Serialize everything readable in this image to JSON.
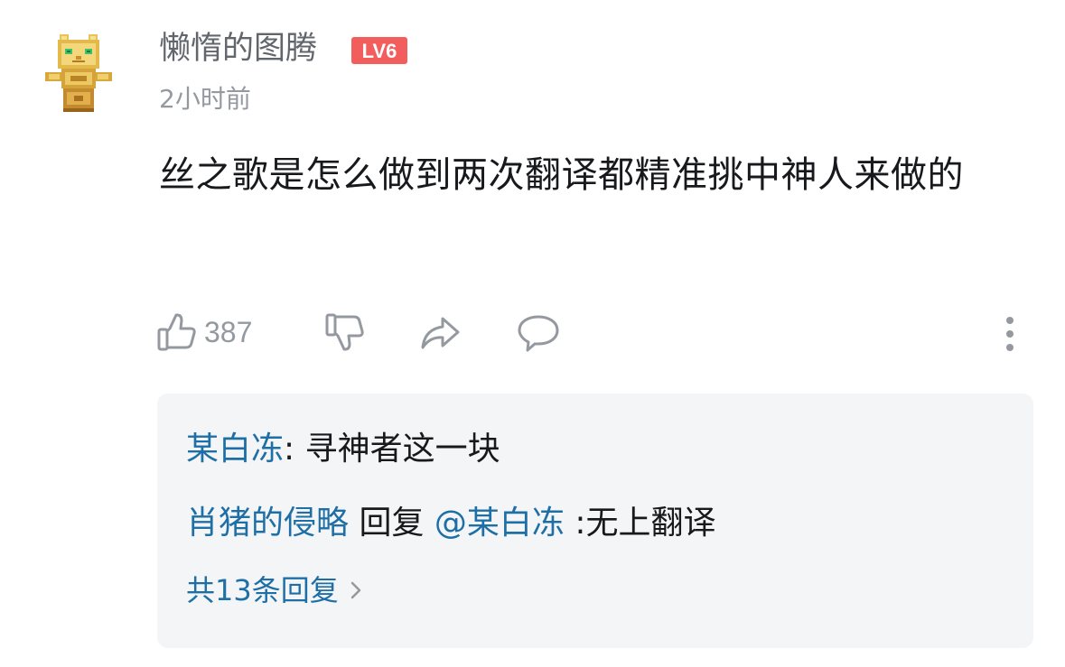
{
  "comment": {
    "username": "懒惰的图腾",
    "level_badge": "LV6",
    "timestamp": "2小时前",
    "text": "丝之歌是怎么做到两次翻译都精准挑中神人来做的"
  },
  "actions": {
    "like_count": "387",
    "icons": [
      "thumbs-up-icon",
      "thumbs-down-icon",
      "share-icon",
      "comment-icon",
      "more-vertical-icon"
    ]
  },
  "replies": {
    "items": [
      {
        "author": "某白冻",
        "separator": ":",
        "text": " 寻神者这一块"
      },
      {
        "author": "肖猪的侵略",
        "reply_word": " 回复 ",
        "mention": "@某白冻",
        "text": " :无上翻译"
      }
    ],
    "more_label": "共13条回复"
  },
  "colors": {
    "link_blue": "#1e6fa6",
    "badge_red": "#f25d5d",
    "muted_gray": "#9499a0",
    "reply_bg": "#f4f5f7"
  }
}
